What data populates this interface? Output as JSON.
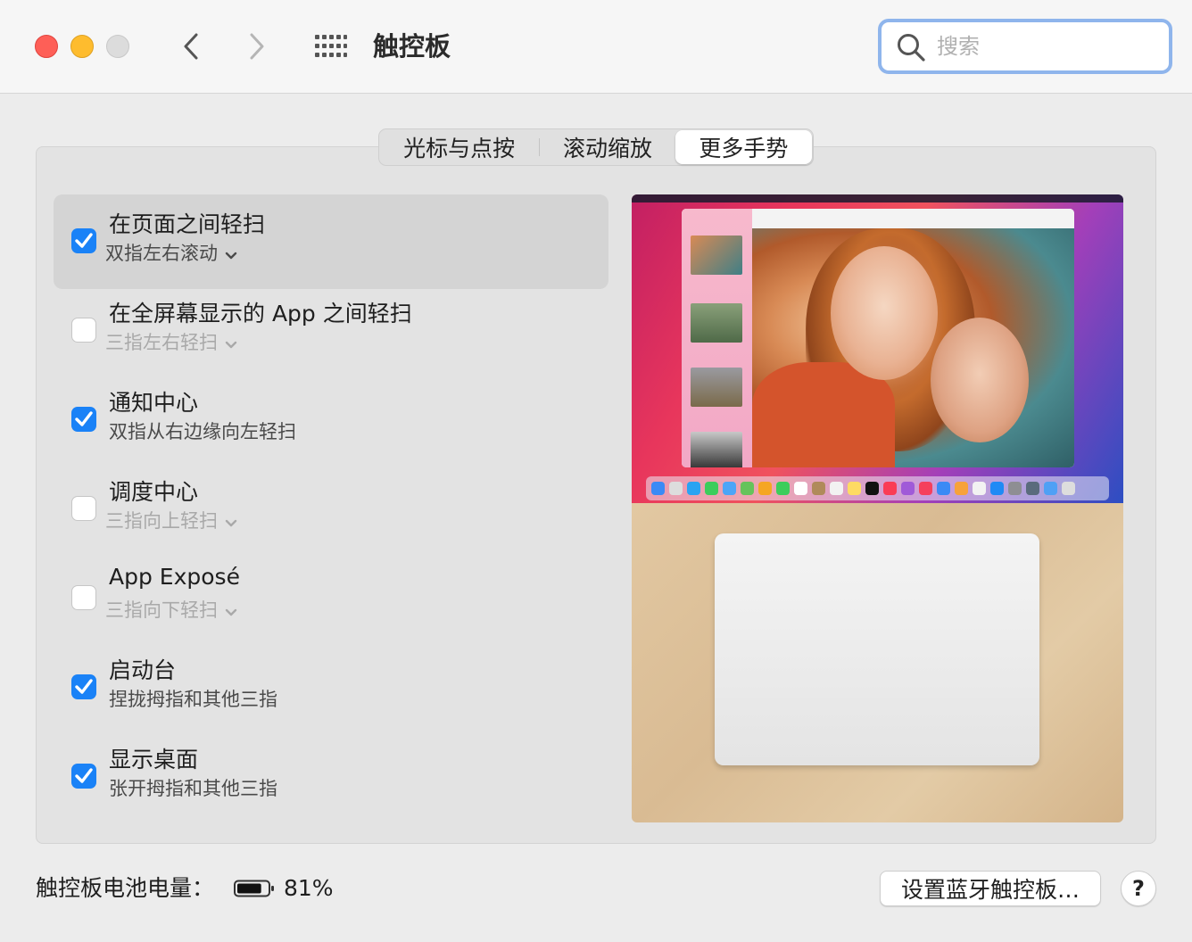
{
  "window": {
    "title": "触控板"
  },
  "search": {
    "placeholder": "搜索",
    "value": ""
  },
  "tabs": [
    {
      "label": "光标与点按",
      "selected": false
    },
    {
      "label": "滚动缩放",
      "selected": false
    },
    {
      "label": "更多手势",
      "selected": true
    }
  ],
  "options": [
    {
      "title": "在页面之间轻扫",
      "subtitle": "双指左右滚动",
      "checked": true,
      "has_menu": true,
      "highlighted": true
    },
    {
      "title": "在全屏幕显示的 App 之间轻扫",
      "subtitle": "三指左右轻扫",
      "checked": false,
      "has_menu": true,
      "highlighted": false
    },
    {
      "title": "通知中心",
      "subtitle": "双指从右边缘向左轻扫",
      "checked": true,
      "has_menu": false,
      "highlighted": false
    },
    {
      "title": "调度中心",
      "subtitle": "三指向上轻扫",
      "checked": false,
      "has_menu": true,
      "highlighted": false
    },
    {
      "title": "App Exposé",
      "subtitle": "三指向下轻扫",
      "checked": false,
      "has_menu": true,
      "highlighted": false
    },
    {
      "title": "启动台",
      "subtitle": "捏拢拇指和其他三指",
      "checked": true,
      "has_menu": false,
      "highlighted": false
    },
    {
      "title": "显示桌面",
      "subtitle": "张开拇指和其他三指",
      "checked": true,
      "has_menu": false,
      "highlighted": false
    }
  ],
  "footer": {
    "battery_label": "触控板电池电量：",
    "battery_percent": "81%",
    "battery_level": 0.81,
    "setup_button": "设置蓝牙触控板…",
    "help_button": "?"
  },
  "colors": {
    "accent": "#1a82f7",
    "close": "#fe5f57",
    "minimize": "#febc2e",
    "zoom_disabled": "#dcdcdc"
  },
  "icons": [
    "back-arrow-icon",
    "forward-arrow-icon",
    "grid-icon",
    "search-icon",
    "checkbox-check-icon",
    "chevron-down-icon",
    "battery-icon"
  ]
}
